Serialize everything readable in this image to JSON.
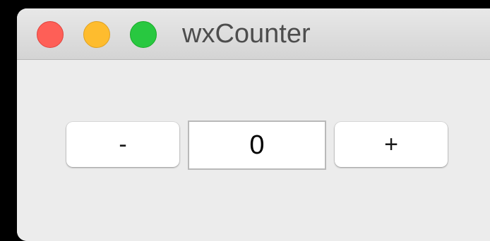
{
  "window": {
    "title": "wxCounter"
  },
  "controls": {
    "decrement_label": "-",
    "increment_label": "+",
    "counter_value": "0"
  },
  "colors": {
    "close": "#fe5f57",
    "minimize": "#febc2e",
    "zoom": "#28c840",
    "window_bg": "#ececec"
  }
}
